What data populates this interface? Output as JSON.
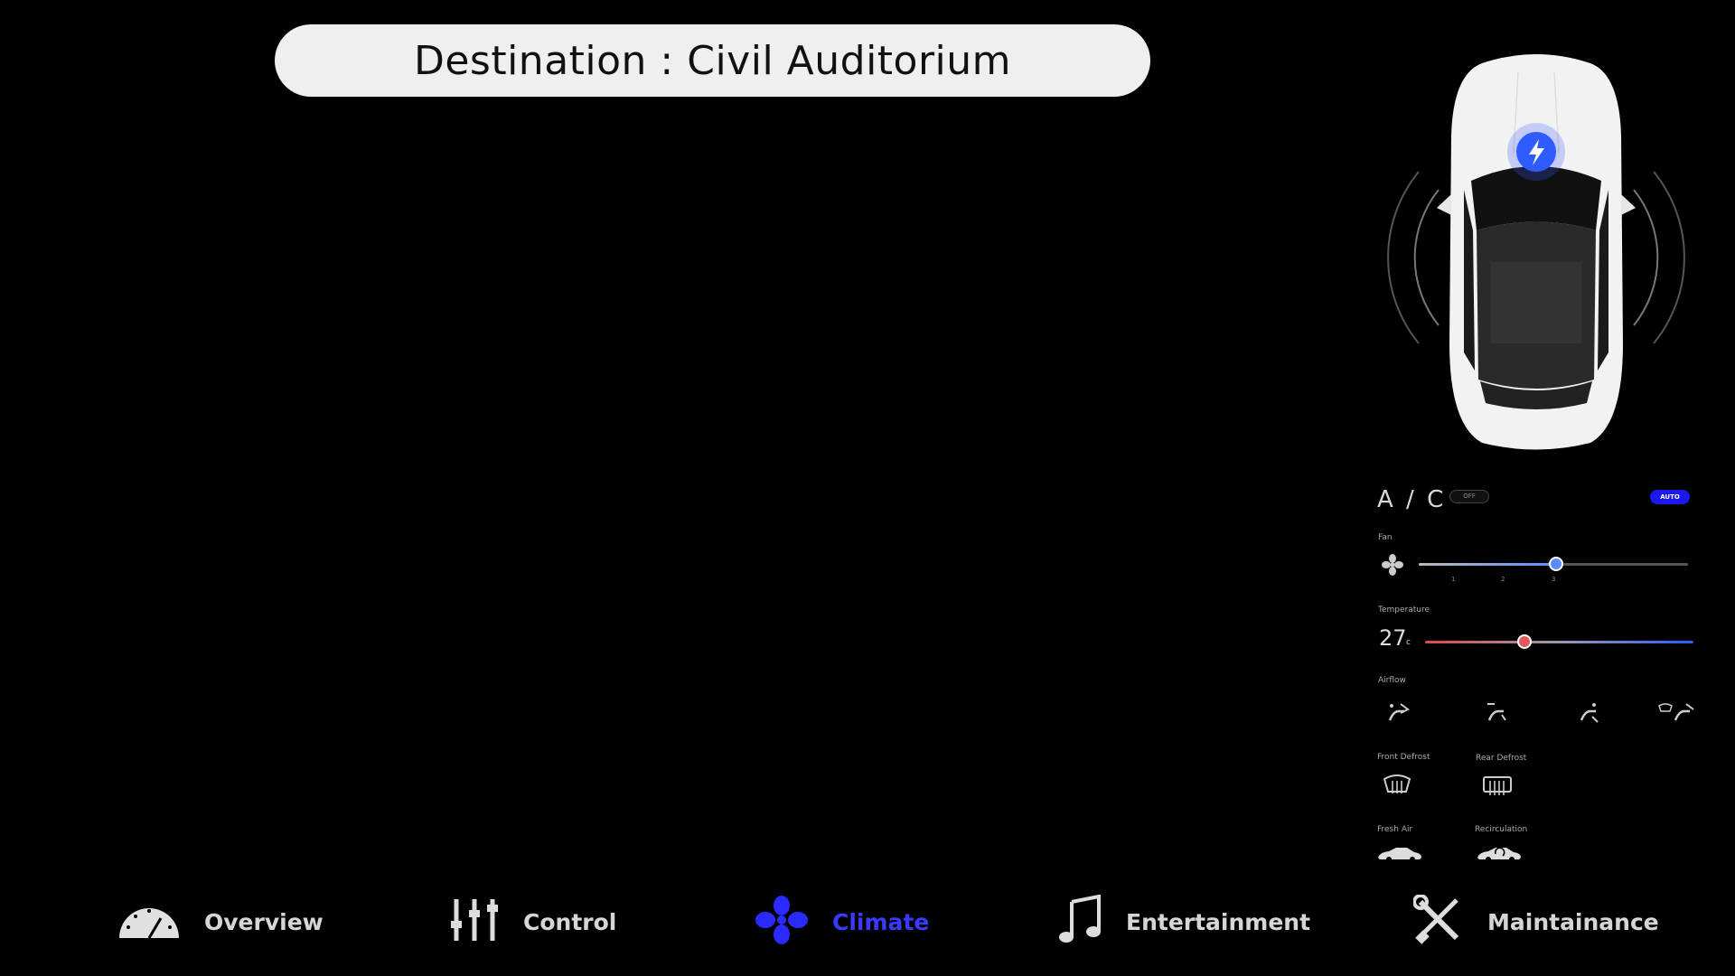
{
  "destination": {
    "text": "Destination : Civil Auditorium"
  },
  "vehicle": {
    "charging_icon": "lightning-bolt-icon",
    "accent_color": "#2f5bff"
  },
  "climate": {
    "ac_title": "A / C",
    "off_label": "OFF",
    "auto_label": "AUTO",
    "fan": {
      "label": "Fan",
      "icon": "fan-icon",
      "ticks": [
        "1",
        "2",
        "3",
        "",
        ""
      ],
      "level": 3,
      "max_level": 5
    },
    "temperature": {
      "label": "Temperature",
      "value": "27",
      "unit": "c",
      "level_fraction": 0.37
    },
    "airflow": {
      "label": "Airflow",
      "modes": [
        "face-vent-icon",
        "face-feet-vent-icon",
        "feet-vent-icon",
        "defrost-feet-vent-icon"
      ]
    },
    "front_defrost": {
      "label": "Front Defrost",
      "icon": "front-defrost-icon"
    },
    "rear_defrost": {
      "label": "Rear Defrost",
      "icon": "rear-defrost-icon"
    },
    "fresh_air": {
      "label": "Fresh Air",
      "icon": "fresh-air-car-icon"
    },
    "recirculation": {
      "label": "Recirculation",
      "icon": "recirculation-car-icon"
    }
  },
  "nav": {
    "items": [
      {
        "label": "Overview",
        "icon": "speedometer-icon"
      },
      {
        "label": "Control",
        "icon": "sliders-icon"
      },
      {
        "label": "Climate",
        "icon": "fan-icon",
        "active": true
      },
      {
        "label": "Entertainment",
        "icon": "music-note-icon"
      },
      {
        "label": "Maintainance",
        "icon": "wrench-screwdriver-icon"
      }
    ],
    "active_color": "#3a3aff"
  }
}
